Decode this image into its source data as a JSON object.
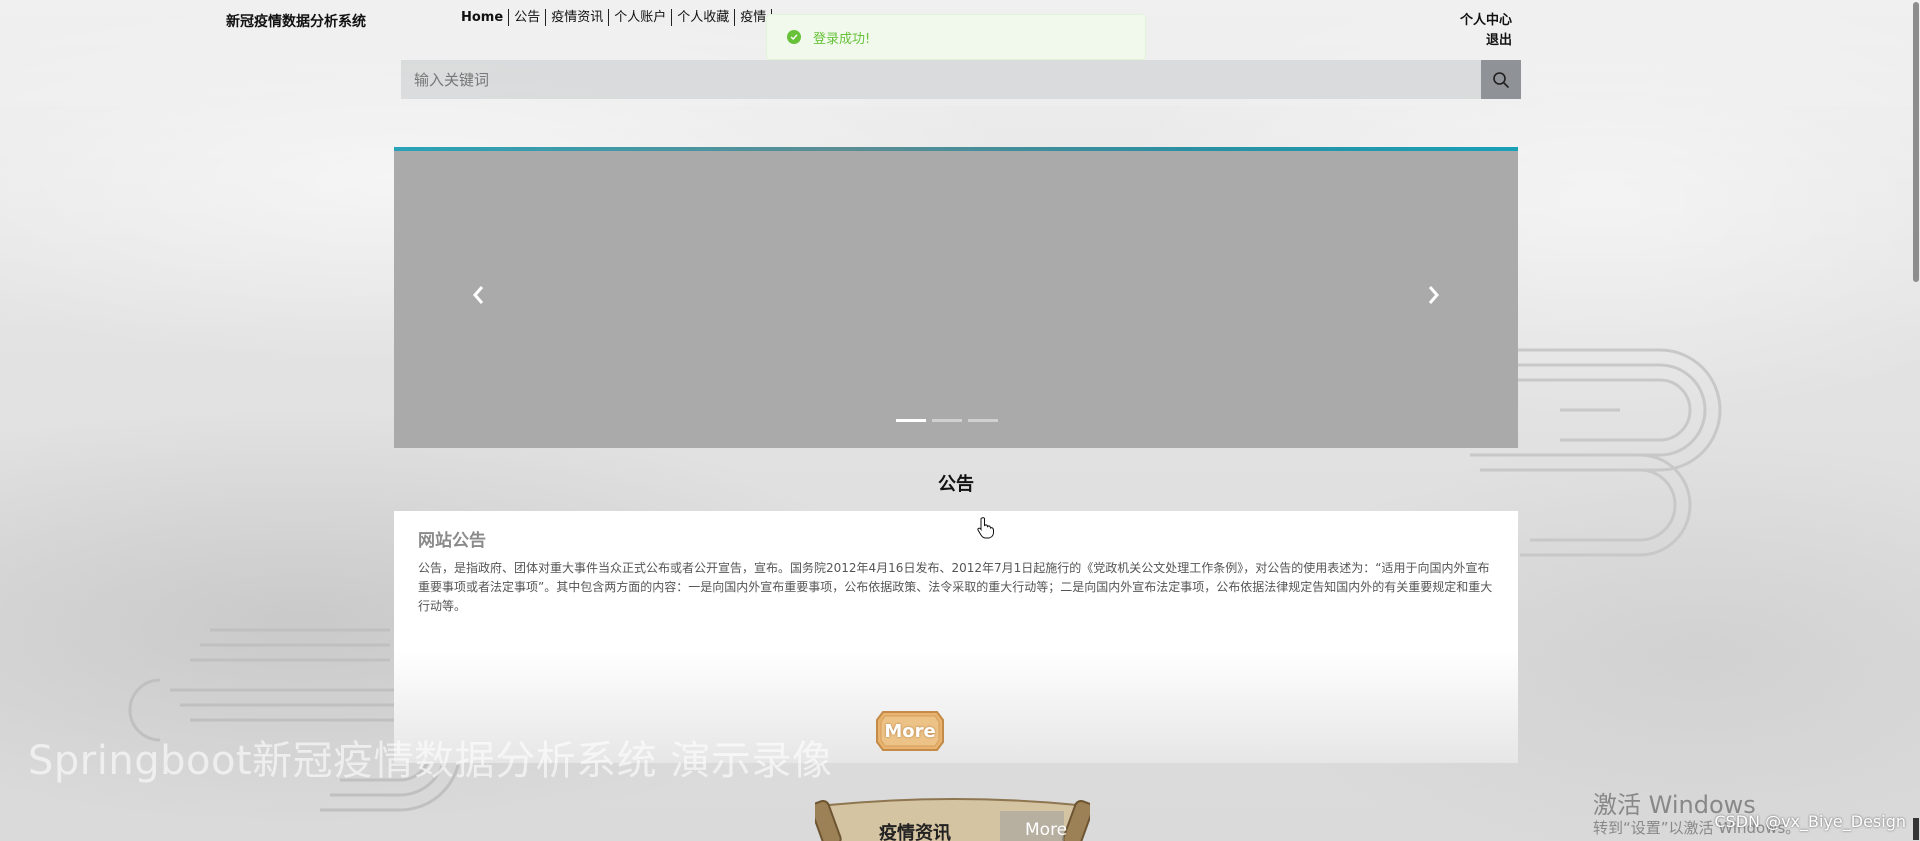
{
  "header": {
    "brand": "新冠疫情数据分析系统",
    "nav": [
      "Home",
      "公告",
      "疫情资讯",
      "个人账户",
      "个人收藏",
      "疫情",
      "",
      "",
      ""
    ],
    "user_center": "个人中心",
    "logout": "退出"
  },
  "search": {
    "placeholder": "输入关键词",
    "value": "",
    "icon": "search-icon"
  },
  "toast": {
    "message": "登录成功!",
    "type": "success"
  },
  "carousel": {
    "slides_count": 3,
    "active_index": 0
  },
  "notice": {
    "section_title": "公告",
    "card_title": "网站公告",
    "body": "公告，是指政府、团体对重大事件当众正式公布或者公开宣告，宣布。国务院2012年4月16日发布、2012年7月1日起施行的《党政机关公文处理工作条例》，对公告的使用表述为：“适用于向国内外宣布重要事项或者法定事项”。其中包含两方面的内容：一是向国内外宣布重要事项，公布依据政策、法令采取的重大行动等；二是向国内外宣布法定事项，公布依据法律规定告知国内外的有关重要规定和重大行动等。",
    "more_label": "More"
  },
  "news": {
    "title": "疫情资讯",
    "more_label": "More"
  },
  "overlays": {
    "video_watermark": "Springboot新冠疫情数据分析系统 演示录像",
    "windows_line1": "激活 Windows",
    "windows_line2": "转到“设置”以激活 Windows。",
    "csdn": "CSDN @vx_Biye_Design"
  },
  "colors": {
    "toast_green": "#67c23a",
    "carousel_grey": "#aaaaaa",
    "search_button": "#8f9296"
  }
}
